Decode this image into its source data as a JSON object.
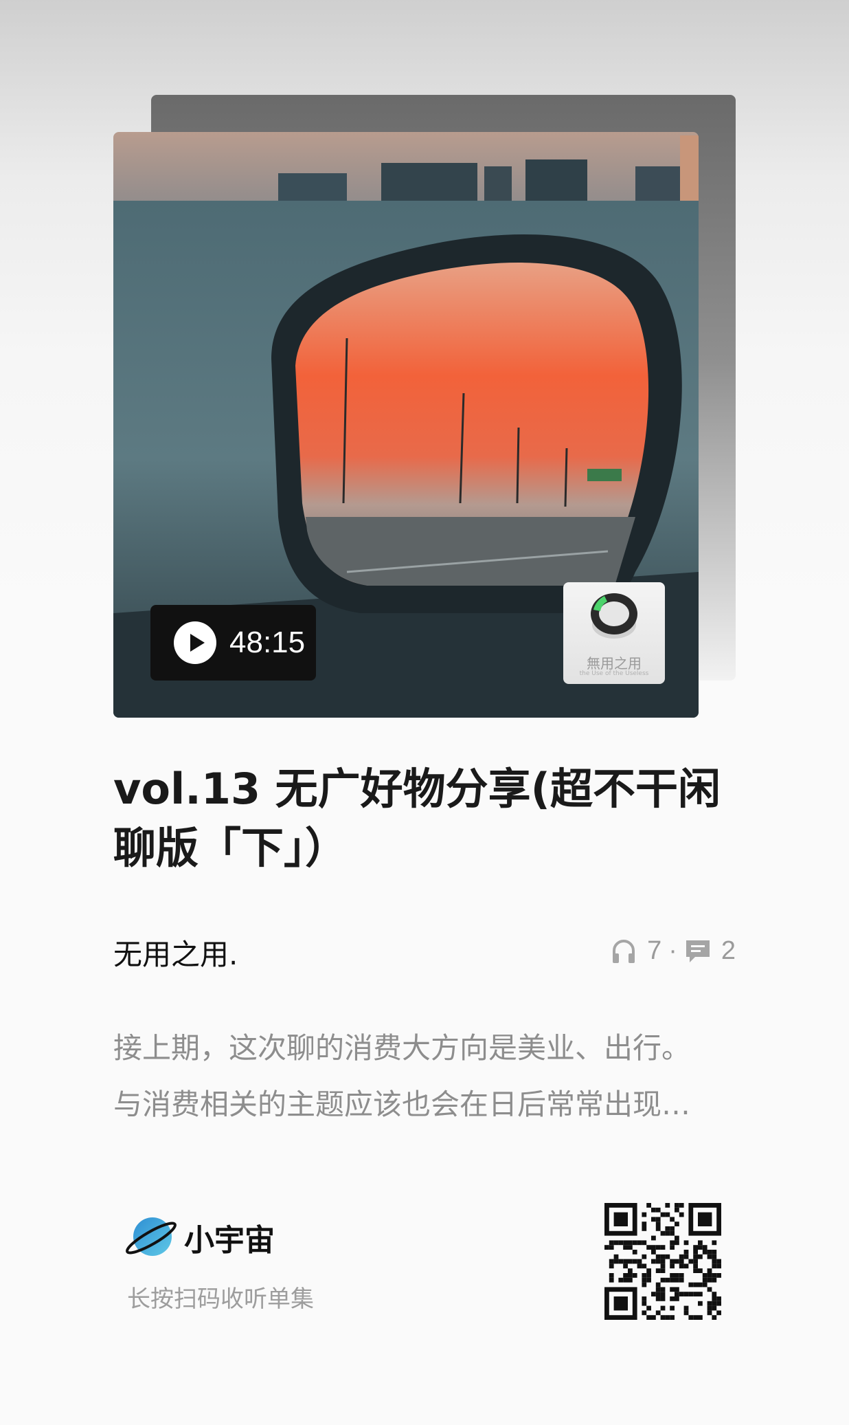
{
  "episode": {
    "duration": "48:15",
    "title": "vol.13 无广好物分享(超不干闲聊版「下」）",
    "podcast_name": "无用之用.",
    "listens": "7",
    "comments": "2",
    "description_lines": [
      "接上期，这次聊的消费大方向是美业、出行。",
      "与消费相关的主题应该也会在日后常常出现…"
    ]
  },
  "cover_logo": {
    "text_cn": "無用之用",
    "text_en": "the Use of the Useless"
  },
  "footer": {
    "brand": "小宇宙",
    "scan_hint": "长按扫码收听单集"
  },
  "icons": {
    "play": "play-icon",
    "listens": "headphones-icon",
    "comments": "comment-icon",
    "brand": "planet-logo-icon",
    "qr": "qr-code-icon"
  },
  "colors": {
    "sunset": "#f2623a",
    "brand_blue": "#3fa9d8",
    "text_gray": "#8d8d8d"
  }
}
